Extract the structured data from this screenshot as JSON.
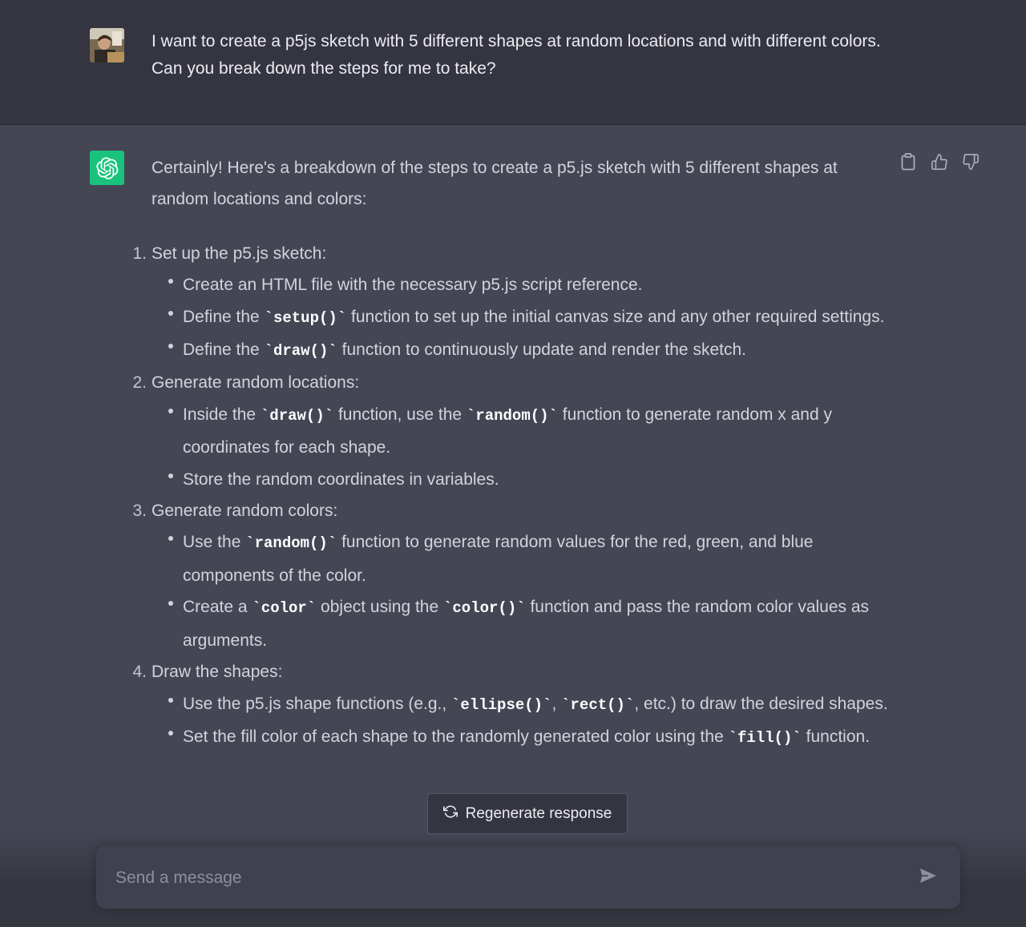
{
  "user_message": {
    "avatar": "user-avatar-photo",
    "text": "I want to create a p5js sketch with 5 different shapes at random locations and with different colors. Can you break down the steps for me to take?"
  },
  "assistant_message": {
    "intro": "Certainly! Here's a breakdown of the steps to create a p5.js sketch with 5 different shapes at random locations and colors:",
    "steps": [
      {
        "num": "1.",
        "title": "Set up the p5.js sketch:",
        "bullets": [
          [
            "Create an HTML file with the necessary p5.js script reference."
          ],
          [
            "Define the ",
            {
              "code": "`setup()`"
            },
            " function to set up the initial canvas size and any other required settings."
          ],
          [
            "Define the ",
            {
              "code": "`draw()`"
            },
            " function to continuously update and render the sketch."
          ]
        ]
      },
      {
        "num": "2.",
        "title": "Generate random locations:",
        "bullets": [
          [
            "Inside the ",
            {
              "code": "`draw()`"
            },
            " function, use the ",
            {
              "code": "`random()`"
            },
            " function to generate random x and y coordinates for each shape."
          ],
          [
            "Store the random coordinates in variables."
          ]
        ]
      },
      {
        "num": "3.",
        "title": "Generate random colors:",
        "bullets": [
          [
            "Use the ",
            {
              "code": "`random()`"
            },
            " function to generate random values for the red, green, and blue components of the color."
          ],
          [
            "Create a ",
            {
              "code": "`color`"
            },
            " object using the ",
            {
              "code": "`color()`"
            },
            " function and pass the random color values as arguments."
          ]
        ]
      },
      {
        "num": "4.",
        "title": "Draw the shapes:",
        "bullets": [
          [
            "Use the p5.js shape functions (e.g., ",
            {
              "code": "`ellipse()`"
            },
            ", ",
            {
              "code": "`rect()`"
            },
            ", etc.) to draw the desired shapes."
          ],
          [
            "Set the fill color of each shape to the randomly generated color using the ",
            {
              "code": "`fill()`"
            },
            " function."
          ]
        ]
      }
    ]
  },
  "actions": {
    "copy_icon": "clipboard-icon",
    "like_icon": "thumbs-up-icon",
    "dislike_icon": "thumbs-down-icon"
  },
  "regenerate": {
    "label": "Regenerate response",
    "icon": "refresh-icon"
  },
  "composer": {
    "placeholder": "Send a message",
    "send_icon": "send-icon"
  },
  "colors": {
    "user_bg": "#343541",
    "assistant_bg": "#444654",
    "brand_green": "#19c37d",
    "text": "#d1d5db",
    "input_bg": "#40414f"
  }
}
